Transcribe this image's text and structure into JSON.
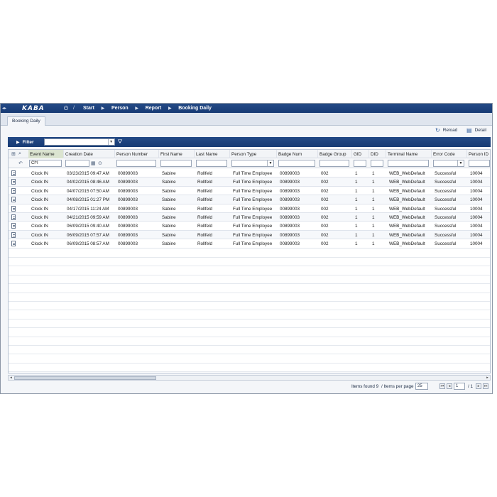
{
  "nav": {
    "logo": "KABA",
    "separator": "/",
    "crumbs": [
      "Start",
      "Person",
      "Report",
      "Booking Daily"
    ]
  },
  "tab": "Booking Daily",
  "toolbar": {
    "reload": "Reload",
    "detail": "Detail"
  },
  "filter": {
    "label": "Filter",
    "selected": ""
  },
  "columns": [
    "Event Name",
    "Creation Date",
    "Person Number",
    "First Name",
    "Last Name",
    "Person Type",
    "Badge Num",
    "Badge Group",
    "GID",
    "DID",
    "Terminal Name",
    "Error Code",
    "Person ID"
  ],
  "filters": {
    "event_name": "Cl*I"
  },
  "rows": [
    [
      "Clock IN",
      "03/23/2015 09:47 AM",
      "00899003",
      "Sabine",
      "Rollfeld",
      "Full Time Employee",
      "00899003",
      "002",
      "1",
      "1",
      "WEB_WebDefault",
      "Successful",
      "10004"
    ],
    [
      "Clock IN",
      "04/02/2015 08:46 AM",
      "00899003",
      "Sabine",
      "Rollfeld",
      "Full Time Employee",
      "00899003",
      "002",
      "1",
      "1",
      "WEB_WebDefault",
      "Successful",
      "10004"
    ],
    [
      "Clock IN",
      "04/07/2015 07:50 AM",
      "00899003",
      "Sabine",
      "Rollfeld",
      "Full Time Employee",
      "00899003",
      "002",
      "1",
      "1",
      "WEB_WebDefault",
      "Successful",
      "10004"
    ],
    [
      "Clock IN",
      "04/08/2015 01:27 PM",
      "00899003",
      "Sabine",
      "Rollfeld",
      "Full Time Employee",
      "00899003",
      "002",
      "1",
      "1",
      "WEB_WebDefault",
      "Successful",
      "10004"
    ],
    [
      "Clock IN",
      "04/17/2015 11:24 AM",
      "00899003",
      "Sabine",
      "Rollfeld",
      "Full Time Employee",
      "00899003",
      "002",
      "1",
      "1",
      "WEB_WebDefault",
      "Successful",
      "10004"
    ],
    [
      "Clock IN",
      "04/21/2015 09:59 AM",
      "00899003",
      "Sabine",
      "Rollfeld",
      "Full Time Employee",
      "00899003",
      "002",
      "1",
      "1",
      "WEB_WebDefault",
      "Successful",
      "10004"
    ],
    [
      "Clock IN",
      "06/09/2015 09:40 AM",
      "00899003",
      "Sabine",
      "Rollfeld",
      "Full Time Employee",
      "00899003",
      "002",
      "1",
      "1",
      "WEB_WebDefault",
      "Successful",
      "10004"
    ],
    [
      "Clock IN",
      "06/09/2015 07:57 AM",
      "00899003",
      "Sabine",
      "Rollfeld",
      "Full Time Employee",
      "00899003",
      "002",
      "1",
      "1",
      "WEB_WebDefault",
      "Successful",
      "10004"
    ],
    [
      "Clock IN",
      "06/09/2015 08:57 AM",
      "00899003",
      "Sabine",
      "Rollfeld",
      "Full Time Employee",
      "00899003",
      "002",
      "1",
      "1",
      "WEB_WebDefault",
      "Successful",
      "10004"
    ]
  ],
  "footer": {
    "items_found": "Items found 9",
    "items_per_page_label": "/ Items per page",
    "items_per_page": "25",
    "page": "1",
    "total_pages": "/ 1"
  },
  "colors": {
    "nav_bg": "#1d3f7a",
    "accent": "#2d5a9a"
  }
}
